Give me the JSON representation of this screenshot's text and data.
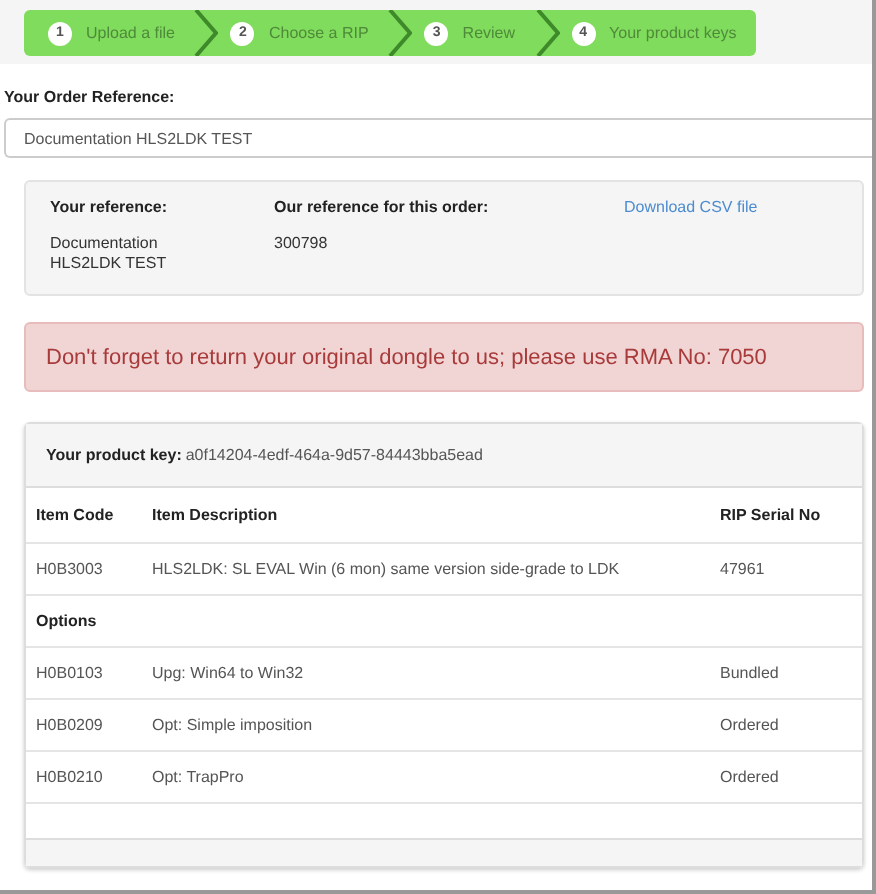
{
  "wizard": {
    "steps": [
      {
        "number": "1",
        "label": "Upload a file"
      },
      {
        "number": "2",
        "label": "Choose a RIP"
      },
      {
        "number": "3",
        "label": "Review"
      },
      {
        "number": "4",
        "label": "Your product keys"
      }
    ]
  },
  "order_reference": {
    "label": "Your Order Reference:",
    "value": "Documentation HLS2LDK TEST"
  },
  "reference_panel": {
    "your_reference_label": "Your reference:",
    "your_reference": "Documentation HLS2LDK TEST",
    "our_reference_label": "Our reference for this order:",
    "our_reference": "300798",
    "download_link": "Download CSV file"
  },
  "alert": "Don't forget to return your original dongle to us; please use RMA No: 7050",
  "product_key": {
    "label": "Your product key:",
    "value": "a0f14204-4edf-464a-9d57-84443bba5ead"
  },
  "table": {
    "columns": [
      "Item Code",
      "Item Description",
      "RIP Serial No"
    ],
    "rows": [
      {
        "kind": "item",
        "cells": [
          "H0B3003",
          "HLS2LDK: SL EVAL Win (6 mon) same version side-grade to LDK",
          "47961"
        ]
      },
      {
        "kind": "section",
        "label": "Options"
      },
      {
        "kind": "item",
        "cells": [
          "H0B0103",
          "Upg: Win64 to Win32",
          "Bundled"
        ]
      },
      {
        "kind": "item",
        "cells": [
          "H0B0209",
          "Opt: Simple imposition",
          "Ordered"
        ]
      },
      {
        "kind": "item",
        "cells": [
          "H0B0210",
          "Opt: TrapPro",
          "Ordered"
        ]
      }
    ]
  }
}
